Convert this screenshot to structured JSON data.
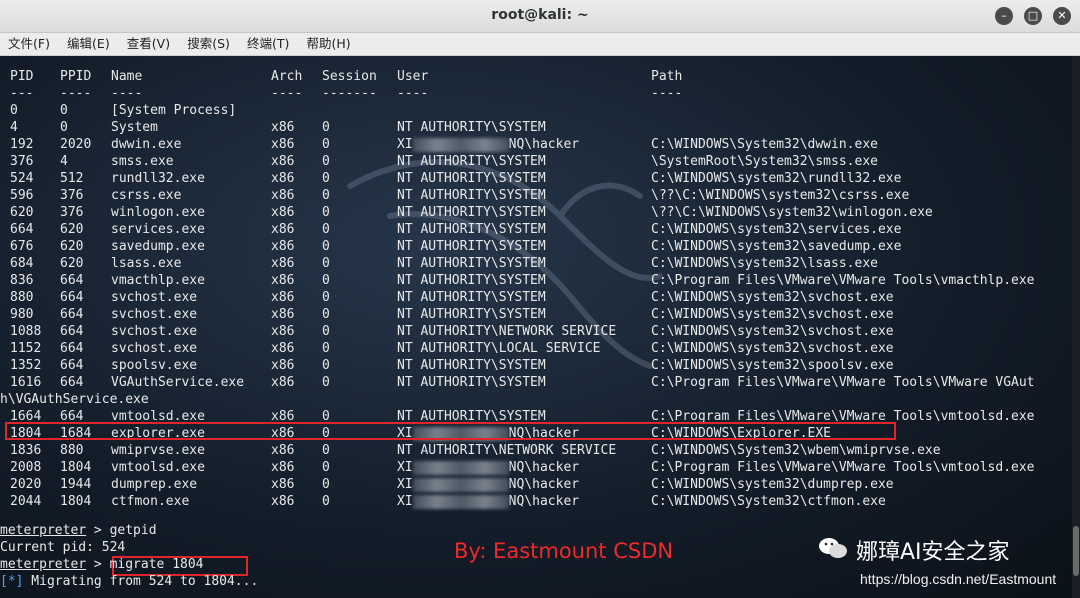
{
  "window": {
    "title": "root@kali: ~",
    "buttons": [
      "–",
      "□",
      "✕"
    ]
  },
  "menu": [
    "文件(F)",
    "编辑(E)",
    "查看(V)",
    "搜索(S)",
    "终端(T)",
    "帮助(H)"
  ],
  "table": {
    "headers": [
      "PID",
      "PPID",
      "Name",
      "Arch",
      "Session",
      "User",
      "Path"
    ],
    "dashes": [
      "---",
      "----",
      "----",
      "----",
      "-------",
      "----",
      "----"
    ],
    "rows": [
      {
        "pid": "0",
        "ppid": "0",
        "name": "[System Process]",
        "arch": "",
        "session": "",
        "user": "",
        "path": ""
      },
      {
        "pid": "4",
        "ppid": "0",
        "name": "System",
        "arch": "x86",
        "session": "0",
        "user": "NT AUTHORITY\\SYSTEM",
        "path": ""
      },
      {
        "pid": "192",
        "ppid": "2020",
        "name": "dwwin.exe",
        "arch": "x86",
        "session": "0",
        "user": "XI",
        "user_tail": "NQ\\hacker",
        "path": "C:\\WINDOWS\\System32\\dwwin.exe"
      },
      {
        "pid": "376",
        "ppid": "4",
        "name": "smss.exe",
        "arch": "x86",
        "session": "0",
        "user": "NT AUTHORITY\\SYSTEM",
        "path": "\\SystemRoot\\System32\\smss.exe"
      },
      {
        "pid": "524",
        "ppid": "512",
        "name": "rundll32.exe",
        "arch": "x86",
        "session": "0",
        "user": "NT AUTHORITY\\SYSTEM",
        "path": "C:\\WINDOWS\\system32\\rundll32.exe"
      },
      {
        "pid": "596",
        "ppid": "376",
        "name": "csrss.exe",
        "arch": "x86",
        "session": "0",
        "user": "NT AUTHORITY\\SYSTEM",
        "path": "\\??\\C:\\WINDOWS\\system32\\csrss.exe"
      },
      {
        "pid": "620",
        "ppid": "376",
        "name": "winlogon.exe",
        "arch": "x86",
        "session": "0",
        "user": "NT AUTHORITY\\SYSTEM",
        "path": "\\??\\C:\\WINDOWS\\system32\\winlogon.exe"
      },
      {
        "pid": "664",
        "ppid": "620",
        "name": "services.exe",
        "arch": "x86",
        "session": "0",
        "user": "NT AUTHORITY\\SYSTEM",
        "path": "C:\\WINDOWS\\system32\\services.exe"
      },
      {
        "pid": "676",
        "ppid": "620",
        "name": "savedump.exe",
        "arch": "x86",
        "session": "0",
        "user": "NT AUTHORITY\\SYSTEM",
        "path": "C:\\WINDOWS\\system32\\savedump.exe"
      },
      {
        "pid": "684",
        "ppid": "620",
        "name": "lsass.exe",
        "arch": "x86",
        "session": "0",
        "user": "NT AUTHORITY\\SYSTEM",
        "path": "C:\\WINDOWS\\system32\\lsass.exe"
      },
      {
        "pid": "836",
        "ppid": "664",
        "name": "vmacthlp.exe",
        "arch": "x86",
        "session": "0",
        "user": "NT AUTHORITY\\SYSTEM",
        "path": "C:\\Program Files\\VMware\\VMware Tools\\vmacthlp.exe"
      },
      {
        "pid": "880",
        "ppid": "664",
        "name": "svchost.exe",
        "arch": "x86",
        "session": "0",
        "user": "NT AUTHORITY\\SYSTEM",
        "path": "C:\\WINDOWS\\system32\\svchost.exe"
      },
      {
        "pid": "980",
        "ppid": "664",
        "name": "svchost.exe",
        "arch": "x86",
        "session": "0",
        "user": "NT AUTHORITY\\SYSTEM",
        "path": "C:\\WINDOWS\\system32\\svchost.exe"
      },
      {
        "pid": "1088",
        "ppid": "664",
        "name": "svchost.exe",
        "arch": "x86",
        "session": "0",
        "user": "NT AUTHORITY\\NETWORK SERVICE",
        "path": "C:\\WINDOWS\\system32\\svchost.exe"
      },
      {
        "pid": "1152",
        "ppid": "664",
        "name": "svchost.exe",
        "arch": "x86",
        "session": "0",
        "user": "NT AUTHORITY\\LOCAL SERVICE",
        "path": "C:\\WINDOWS\\system32\\svchost.exe"
      },
      {
        "pid": "1352",
        "ppid": "664",
        "name": "spoolsv.exe",
        "arch": "x86",
        "session": "0",
        "user": "NT AUTHORITY\\SYSTEM",
        "path": "C:\\WINDOWS\\system32\\spoolsv.exe"
      },
      {
        "pid": "1616",
        "ppid": "664",
        "name": "VGAuthService.exe",
        "arch": "x86",
        "session": "0",
        "user": "NT AUTHORITY\\SYSTEM",
        "path": "C:\\Program Files\\VMware\\VMware Tools\\VMware VGAut"
      },
      {
        "wrap": "h\\VGAuthService.exe"
      },
      {
        "pid": "1664",
        "ppid": "664",
        "name": "vmtoolsd.exe",
        "arch": "x86",
        "session": "0",
        "user": "NT AUTHORITY\\SYSTEM",
        "path": "C:\\Program Files\\VMware\\VMware Tools\\vmtoolsd.exe"
      },
      {
        "pid": "1804",
        "ppid": "1684",
        "name": "explorer.exe",
        "arch": "x86",
        "session": "0",
        "user": "XI",
        "user_tail": "NQ\\hacker",
        "path": "C:\\WINDOWS\\Explorer.EXE"
      },
      {
        "pid": "1836",
        "ppid": "880",
        "name": "wmiprvse.exe",
        "arch": "x86",
        "session": "0",
        "user": "NT AUTHORITY\\NETWORK SERVICE",
        "path": "C:\\WINDOWS\\System32\\wbem\\wmiprvse.exe"
      },
      {
        "pid": "2008",
        "ppid": "1804",
        "name": "vmtoolsd.exe",
        "arch": "x86",
        "session": "0",
        "user": "XI",
        "user_tail": "NQ\\hacker",
        "path": "C:\\Program Files\\VMware\\VMware Tools\\vmtoolsd.exe"
      },
      {
        "pid": "2020",
        "ppid": "1944",
        "name": "dumprep.exe",
        "arch": "x86",
        "session": "0",
        "user": "XI",
        "user_tail": "NQ\\hacker",
        "path": "C:\\WINDOWS\\system32\\dumprep.exe"
      },
      {
        "pid": "2044",
        "ppid": "1804",
        "name": "ctfmon.exe",
        "arch": "x86",
        "session": "0",
        "user": "XI",
        "user_tail": "NQ\\hacker",
        "path": "C:\\WINDOWS\\System32\\ctfmon.exe"
      }
    ]
  },
  "console": {
    "prompt": "meterpreter",
    "cmd1": " > getpid",
    "pid_line": "Current pid: 524",
    "cmd2_prefix": " > ",
    "cmd2": "migrate 1804",
    "status_tag": "[*]",
    "status": " Migrating from 524 to 1804..."
  },
  "overlay": {
    "byline": "By: Eastmount CSDN",
    "watermark": "娜璋AI安全之家",
    "url": "https://blog.csdn.net/Eastmount"
  },
  "colors": {
    "highlight": "#e0262b",
    "byline": "#ee2a2a",
    "tag": "#5b9bff"
  }
}
